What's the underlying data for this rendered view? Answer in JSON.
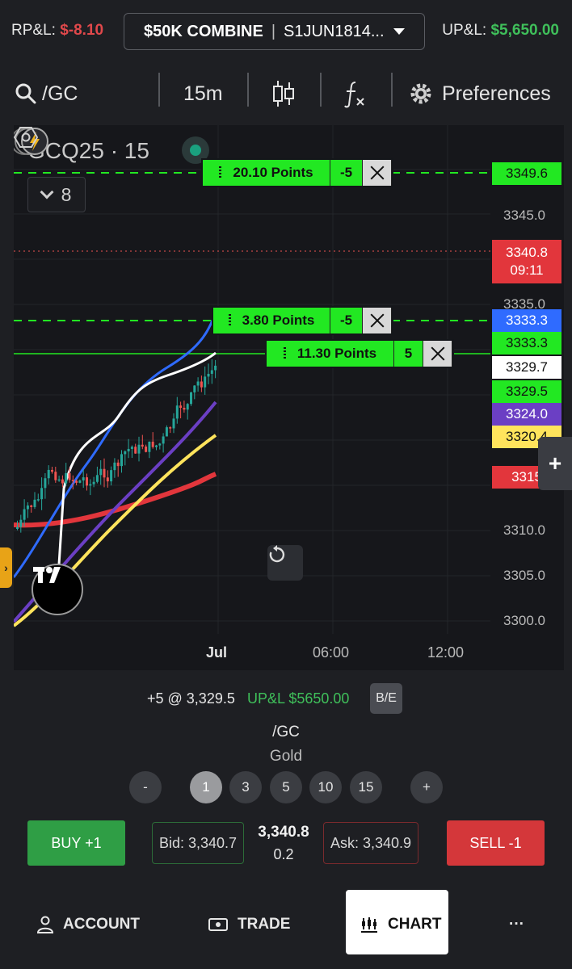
{
  "topbar": {
    "rpnl_label": "RP&L:",
    "rpnl_value": "$-8.10",
    "account_name": "$50K COMBINE",
    "account_sep": "|",
    "account_id": "S1JUN1814...",
    "upnl_label": "UP&L:",
    "upnl_value": "$5,650.00"
  },
  "toolbar": {
    "symbol": "/GC",
    "timeframe": "15m",
    "preferences_label": "Preferences"
  },
  "chart": {
    "symbol_title": "GCQ25 · 15",
    "indicator_count": "8",
    "y_ticks": [
      "3345.0",
      "3335.0",
      "3310.0",
      "3305.0",
      "3300.0"
    ],
    "x_ticks": [
      "Jul",
      "06:00",
      "12:00"
    ],
    "price_tags": [
      {
        "label": "3349.6",
        "bg": "#22e822",
        "fg": "#111111"
      },
      {
        "label": "3340.8",
        "sub": "09:11",
        "bg": "#e2363c",
        "fg": "#ffffff"
      },
      {
        "label": "3333.3",
        "bg": "#2f6bff",
        "fg": "#ffffff"
      },
      {
        "label": "3333.3",
        "bg": "#22e822",
        "fg": "#111111"
      },
      {
        "label": "3329.7",
        "bg": "#ffffff",
        "fg": "#111111"
      },
      {
        "label": "3329.5",
        "bg": "#22e822",
        "fg": "#111111"
      },
      {
        "label": "3324.0",
        "bg": "#6b3fc4",
        "fg": "#ffffff"
      },
      {
        "label": "3320.4",
        "bg": "#ffe45c",
        "fg": "#111111"
      },
      {
        "label": "3315",
        "bg": "#e2363c",
        "fg": "#ffffff"
      }
    ],
    "orders": [
      {
        "label": "20.10 Points",
        "qty": "-5"
      },
      {
        "label": "3.80 Points",
        "qty": "-5"
      },
      {
        "label": "11.30 Points",
        "qty": "5"
      }
    ],
    "colors": {
      "up": "#26a69a",
      "down": "#ef5350",
      "order_green": "#22e822",
      "blue_ma": "#2f6bff",
      "white_ma": "#ffffff",
      "purple_ma": "#6b3fc4",
      "yellow_ma": "#ffe45c",
      "red_ma": "#e2363c"
    }
  },
  "position": {
    "summary": "+5 @ 3,329.5",
    "upnl": "UP&L $5650.00",
    "be_label": "B/E",
    "symbol": "/GC",
    "name": "Gold"
  },
  "quantities": {
    "minus": "-",
    "items": [
      "1",
      "3",
      "5",
      "10",
      "15"
    ],
    "plus": "+"
  },
  "trade": {
    "buy_label": "BUY +1",
    "bid": "Bid: 3,340.7",
    "last": "3,340.8",
    "spread": "0.2",
    "ask": "Ask: 3,340.9",
    "sell_label": "SELL -1"
  },
  "nav": {
    "account": "ACCOUNT",
    "trade": "TRADE",
    "chart": "CHART",
    "more": "···"
  }
}
